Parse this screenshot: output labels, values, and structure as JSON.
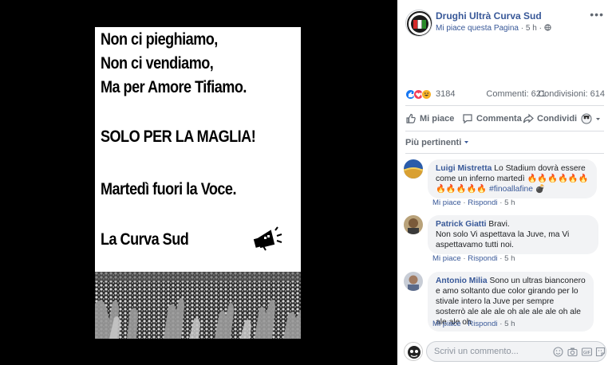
{
  "poster": {
    "line1": "Non ci pieghiamo,",
    "line2": "Non ci vendiamo,",
    "line3": "Ma per Amore Tifiamo.",
    "line4": "SOLO PER LA MAGLIA!",
    "line5": "Martedì fuori la Voce.",
    "line6": "La Curva Sud"
  },
  "post": {
    "page_name": "Drughi Ultrà Curva Sud",
    "like_page": "Mi piace questa Pagina",
    "separator": "·",
    "time": "5 h",
    "more": "•••"
  },
  "stats": {
    "reactions": "3184",
    "comments": "Commenti: 621",
    "shares": "Condivisioni: 614"
  },
  "actions": {
    "like": "Mi piace",
    "comment": "Commenta",
    "share": "Condividi"
  },
  "sort": {
    "label": "Più pertinenti"
  },
  "comments": [
    {
      "author": "Luigi Mistretta",
      "text_a": "Lo Stadium dovrà essere come un inferno martedì",
      "text_b": "#finoallafine",
      "like": "Mi piace",
      "reply": "Rispondi",
      "dot": "·",
      "time": "5 h"
    },
    {
      "author": "Patrick Giatti",
      "text": "Bravi.",
      "text2": "Non solo Vi aspettava la Juve, ma Vi aspettavamo tutti noi.",
      "like": "Mi piace",
      "reply": "Rispondi",
      "dot": "·",
      "time": "5 h"
    },
    {
      "author": "Antonio Milia",
      "text": "Sono un ultras bianconero e amo soltanto due color girando per lo stivale intero la Juve per sempre sosterrò ale ale ale oh ale ale ale oh ale ale ale oh",
      "like": "Mi piace",
      "reply": "Rispondi",
      "dot": "·",
      "time": "5 h"
    }
  ],
  "composer": {
    "placeholder": "Scrivi un commento..."
  },
  "colors": {
    "link": "#385898",
    "muted": "#606770",
    "bubble": "#f2f3f5",
    "fire": "#f7630c"
  }
}
